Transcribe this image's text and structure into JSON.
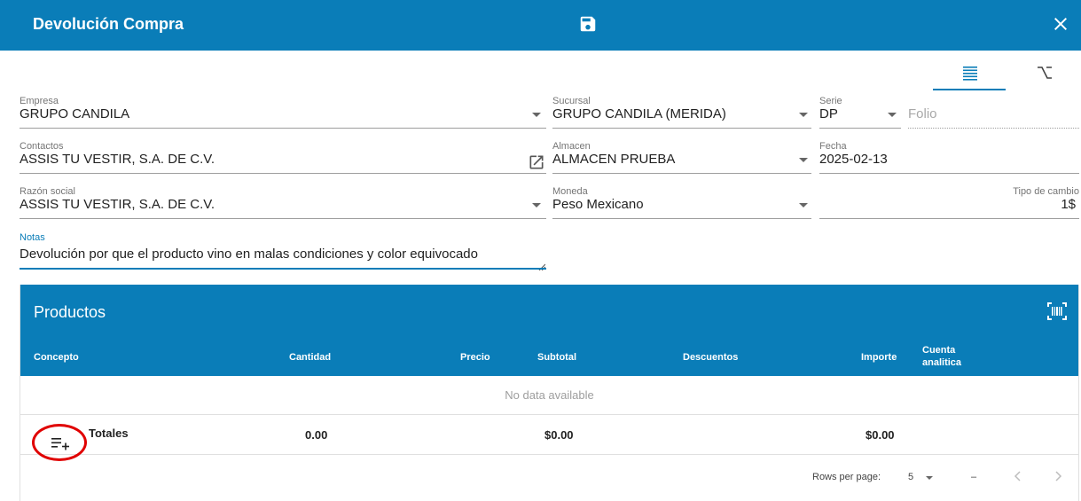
{
  "window": {
    "title": "Devolución Compra"
  },
  "icons": {
    "save": "floppy-disk-icon",
    "close": "close-icon",
    "list_view": "list-view-icon",
    "alt_view": "option-key-icon",
    "open_external": "open-in-new-icon",
    "barcode": "barcode-scan-icon",
    "add_row": "playlist-add-icon"
  },
  "form": {
    "empresa": {
      "label": "Empresa",
      "value": "GRUPO CANDILA"
    },
    "sucursal": {
      "label": "Sucursal",
      "value": "GRUPO CANDILA (MERIDA)"
    },
    "serie": {
      "label": "Serie",
      "value": "DP"
    },
    "folio": {
      "placeholder": "Folio"
    },
    "contactos": {
      "label": "Contactos",
      "value": "ASSIS TU VESTIR, S.A. DE C.V."
    },
    "almacen": {
      "label": "Almacen",
      "value": "ALMACEN PRUEBA"
    },
    "fecha": {
      "label": "Fecha",
      "value": "2025-02-13"
    },
    "razon_social": {
      "label": "Razón social",
      "value": "ASSIS TU VESTIR, S.A. DE C.V."
    },
    "moneda": {
      "label": "Moneda",
      "value": "Peso Mexicano"
    },
    "tipo_cambio": {
      "label": "Tipo de cambio",
      "value": "1$"
    },
    "notas": {
      "label": "Notas",
      "value": "Devolución por que el producto vino en malas condiciones y color equivocado"
    }
  },
  "products": {
    "title": "Productos",
    "columns": {
      "concepto": "Concepto",
      "cantidad": "Cantidad",
      "precio": "Precio",
      "subtotal": "Subtotal",
      "descuentos": "Descuentos",
      "importe": "Importe",
      "cuenta_1": "Cuenta",
      "cuenta_2": "analitica"
    },
    "empty_text": "No data available",
    "totals": {
      "label": "Totales",
      "cantidad": "0.00",
      "subtotal": "$0.00",
      "importe": "$0.00"
    }
  },
  "pager": {
    "rows_label": "Rows per page:",
    "rows_value": "5",
    "range": "–"
  },
  "colors": {
    "primary": "#0a7db8",
    "highlight_circle": "#e00000"
  }
}
